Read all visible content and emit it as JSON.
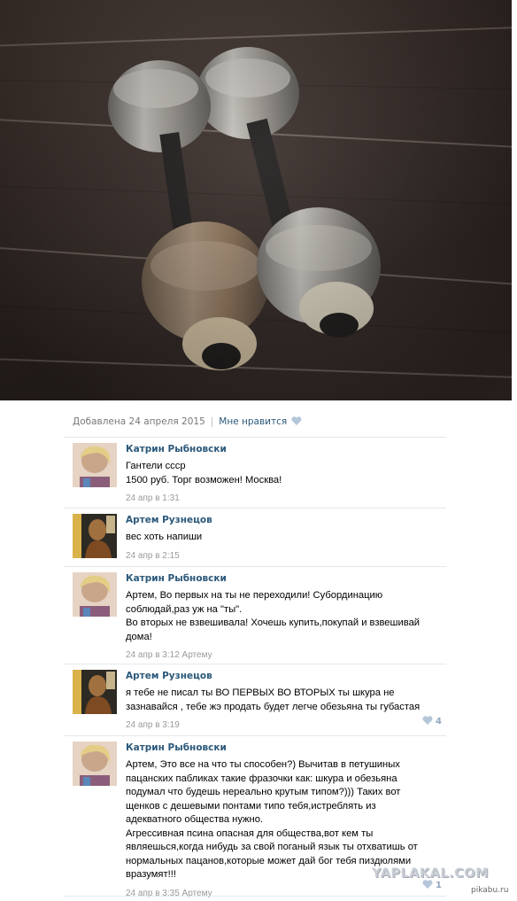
{
  "post": {
    "added_date": "Добавлена 24 апреля 2015",
    "like_label": "Мне нравится",
    "comments": [
      {
        "author": "Катрин Рыбновски",
        "text": "Гантели ссср\n1500 руб. Торг возможен! Москва!",
        "date": "24 апр в 1:31",
        "likes": ""
      },
      {
        "author": "Артем Рузнецов",
        "text": "вес хоть напиши",
        "date": "24 апр в 2:15",
        "likes": ""
      },
      {
        "author": "Катрин Рыбновски",
        "text": "Артем, Во первых на ты не переходили! Субординацию\nсоблюдай,раз уж на \"ты\".\nВо вторых не взвешивала! Хочешь купить,покупай и взвешивай\nдома!",
        "date": "24 апр в 3:12 Артему",
        "likes": ""
      },
      {
        "author": "Артем Рузнецов",
        "text": "я тебе не писал ты ВО ПЕРВЫХ ВО ВТОРЫХ ты шкура не\nзазнавайся , тебе жэ продать будет легче обезьяна ты губастая",
        "date": "24 апр в 3:19",
        "likes": "4"
      },
      {
        "author": "Катрин Рыбновски",
        "text": "Артем, Это все на что ты способен?) Вычитав в петушиных\nпацанских пабликах такие фразочки как: шкура и обезьяна\nподумал что будешь нереально крутым типом?))) Таких вот\nщенков с дешевыми понтами типо тебя,истреблять из\nадекватного общества нужно.\nАгрессивная псина опасная для общества,вот кем ты\nявляешься,когда нибудь за свой поганый язык ты отхватишь от\nнормальных пацанов,которые может дай бог тебя пиздюлями\nвразумят!!!",
        "date": "24 апр в 3:35 Артему",
        "likes": "1"
      }
    ]
  },
  "watermarks": {
    "yaplakal": "YAPLAKAL.COM",
    "pikabu": "pikabu.ru"
  },
  "icons": {
    "like": "heart-icon",
    "photo": "dumbbells-photo"
  },
  "colors": {
    "link": "#2b587a",
    "meta": "#777777",
    "divider": "#e4e8ee",
    "heart": "#b5c6d9"
  }
}
